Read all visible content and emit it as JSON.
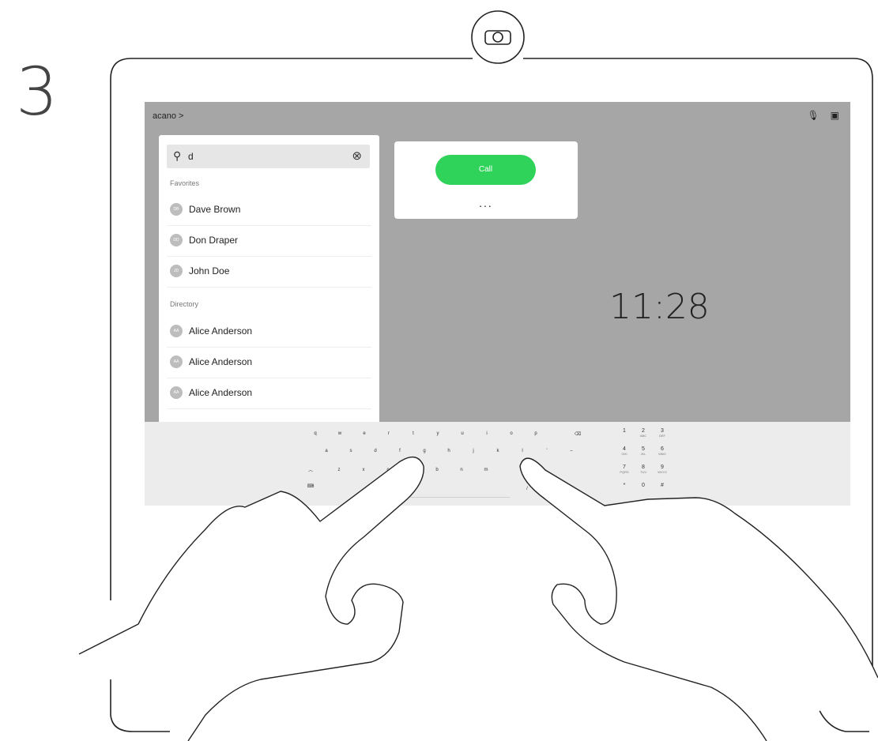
{
  "step_number": "3",
  "screen": {
    "breadcrumb": "acano >",
    "top_icons": [
      "mic-icon",
      "self-view-icon"
    ],
    "search": {
      "value": "d"
    },
    "favorites_label": "Favorites",
    "favorites": [
      {
        "initials": "DB",
        "name": "Dave Brown"
      },
      {
        "initials": "DD",
        "name": "Don Draper"
      },
      {
        "initials": "JD",
        "name": "John Doe"
      }
    ],
    "directory_label": "Directory",
    "directory": [
      {
        "initials": "AA",
        "name": "Alice Anderson"
      },
      {
        "initials": "AA",
        "name": "Alice Anderson"
      },
      {
        "initials": "AA",
        "name": "Alice Anderson"
      }
    ],
    "call_button": "Call",
    "more_label": "...",
    "clock": "11:28",
    "keyboard": {
      "row1": [
        "q",
        "w",
        "e",
        "r",
        "t",
        "y",
        "u",
        "i",
        "o",
        "p"
      ],
      "row2": [
        "a",
        "s",
        "d",
        "f",
        "g",
        "h",
        "j",
        "k",
        "l",
        "'",
        "–"
      ],
      "row3": [
        "z",
        "x",
        "c",
        "v",
        "b",
        "n",
        "m"
      ],
      "slash": "/",
      "numpad": [
        {
          "n": "1",
          "l": ""
        },
        {
          "n": "2",
          "l": "ABC"
        },
        {
          "n": "3",
          "l": "DEF"
        },
        {
          "n": "4",
          "l": "GHI"
        },
        {
          "n": "5",
          "l": "JKL"
        },
        {
          "n": "6",
          "l": "MNO"
        },
        {
          "n": "7",
          "l": "PQRS"
        },
        {
          "n": "8",
          "l": "TUV"
        },
        {
          "n": "9",
          "l": "WXYZ"
        },
        {
          "n": "*",
          "l": ""
        },
        {
          "n": "0",
          "l": ""
        },
        {
          "n": "#",
          "l": ""
        }
      ]
    }
  }
}
